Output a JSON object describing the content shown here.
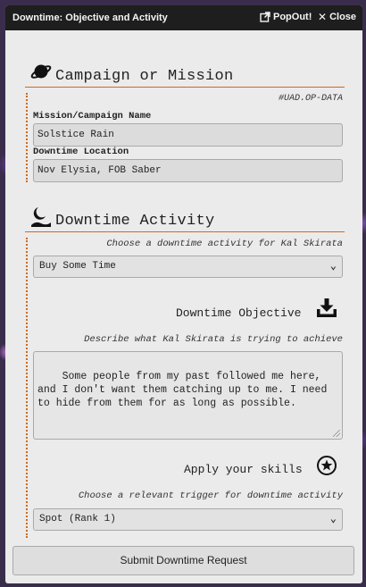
{
  "window": {
    "title": "Downtime: Objective and Activity",
    "popout_label": "PopOut!",
    "close_label": "Close"
  },
  "campaign": {
    "heading": "Campaign or Mission",
    "tag": "#UAD.OP-DATA",
    "mission_label": "Mission/Campaign Name",
    "mission_value": "Solstice Rain",
    "location_label": "Downtime Location",
    "location_value": "Nov Elysia, FOB Saber"
  },
  "activity": {
    "heading": "Downtime Activity",
    "choose_hint": "Choose a downtime activity for Kal Skirata",
    "activity_selected": "Buy Some Time",
    "objective_heading": "Downtime Objective",
    "objective_hint": "Describe what Kal Skirata is trying to achieve",
    "objective_text": "Some people from my past followed me here, and I don't want them catching up to me. I need to hide from them for as long as possible.",
    "skills_heading": "Apply your skills",
    "trigger_hint": "Choose a relevant trigger for downtime activity",
    "trigger_selected": "Spot (Rank 1)"
  },
  "submit_label": "Submit Downtime Request",
  "colors": {
    "accent": "#d06a18",
    "titlebar": "#1e1e1e",
    "panel": "#ebebeb"
  },
  "icons": {
    "campaign": "planet-icon",
    "activity": "moon-landscape-icon",
    "objective": "download-tray-icon",
    "skills": "star-circle-icon",
    "popout": "external-link-icon",
    "close": "close-icon",
    "select": "chevron-down-icon"
  }
}
